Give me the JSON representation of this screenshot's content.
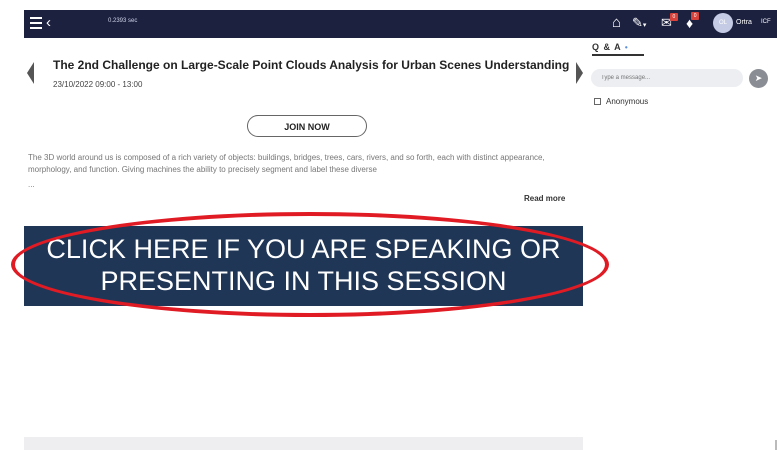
{
  "topbar": {
    "timing": "0.2393 sec",
    "user": {
      "initials": "OL",
      "name": "Ortra",
      "org": "ICF"
    },
    "mail_badge": "0",
    "bell_badge": "0",
    "caret": "▾"
  },
  "session": {
    "title": "The 2nd Challenge on Large-Scale Point Clouds Analysis for Urban Scenes Understanding",
    "datetime": "23/10/2022 09:00 - 13:00",
    "join_label": "JOIN NOW",
    "description": "The 3D world around us is composed of a rich variety of objects: buildings, bridges, trees, cars, rivers, and so forth, each with distinct appearance, morphology, and function. Giving machines the ability to precisely segment and label these diverse",
    "ellipsis": "...",
    "read_more": "Read more"
  },
  "banner": {
    "line1": "CLICK HERE IF YOU ARE SPEAKING OR",
    "line2": "PRESENTING IN THIS SESSION"
  },
  "qa": {
    "header": "Q & A",
    "header_dot": "•",
    "placeholder": "Type a message...",
    "anonymous_label": "Anonymous"
  },
  "colors": {
    "topbar": "#1c2140",
    "banner": "#1f3657",
    "highlight_oval": "#e01b24",
    "badge": "#d9423b"
  },
  "icons": [
    "menu-icon",
    "back-chevron-icon",
    "home-icon",
    "edit-icon",
    "mail-icon",
    "bell-icon",
    "send-icon",
    "carousel-left-icon",
    "carousel-right-icon"
  ]
}
